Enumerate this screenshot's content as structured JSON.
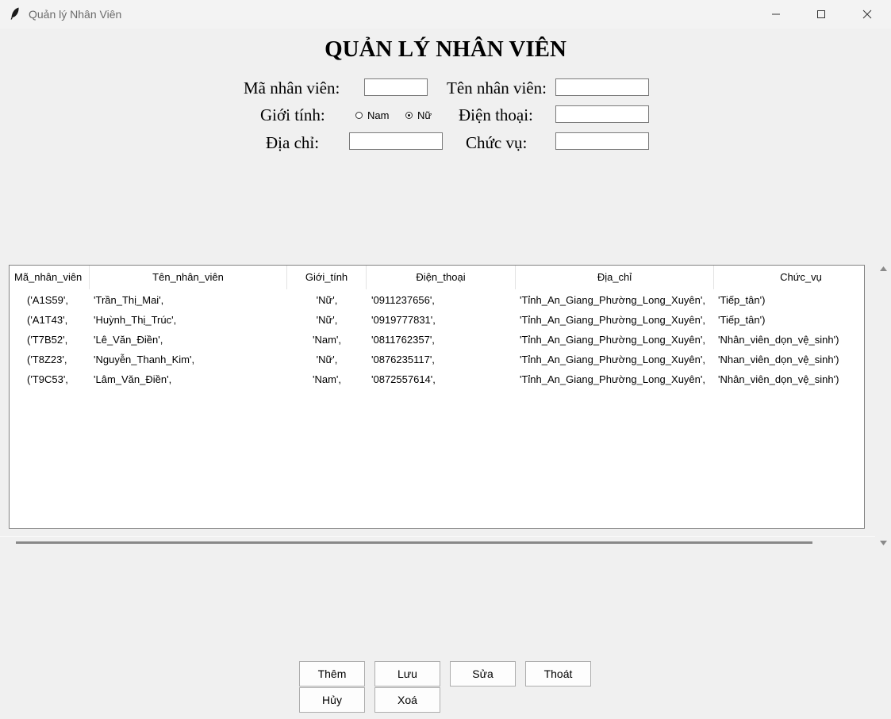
{
  "window": {
    "title": "Quản lý Nhân Viên"
  },
  "form": {
    "heading": "QUẢN LÝ NHÂN VIÊN",
    "ma_label": "Mã nhân viên:",
    "ten_label": "Tên nhân viên:",
    "gioitinh_label": "Giới tính:",
    "radio_nam": "Nam",
    "radio_nu": "Nữ",
    "gender_selected": "Nữ",
    "dienthoai_label": "Điện thoại:",
    "diachi_label": "Địa chỉ:",
    "chucvu_label": "Chức vụ:",
    "ma_value": "",
    "ten_value": "",
    "dienthoai_value": "",
    "diachi_value": "",
    "chucvu_value": ""
  },
  "table": {
    "columns": [
      "Mã_nhân_viên",
      "Tên_nhân_viên",
      "Giới_tính",
      "Điện_thoại",
      "Địa_chỉ",
      "Chức_vụ"
    ],
    "rows": [
      [
        "('A1S59',",
        "'Trần_Thị_Mai',",
        "'Nữ',",
        "'0911237656',",
        "'Tỉnh_An_Giang_Phường_Long_Xuyên',",
        "'Tiếp_tân')"
      ],
      [
        "('A1T43',",
        "'Huỳnh_Thị_Trúc',",
        "'Nữ',",
        "'0919777831',",
        "'Tỉnh_An_Giang_Phường_Long_Xuyên',",
        "'Tiếp_tân')"
      ],
      [
        "('T7B52',",
        "'Lê_Văn_Điền',",
        "'Nam',",
        "'0811762357',",
        "'Tỉnh_An_Giang_Phường_Long_Xuyên',",
        "'Nhân_viên_dọn_vệ_sinh')"
      ],
      [
        "('T8Z23',",
        "'Nguyễn_Thanh_Kim',",
        "'Nữ',",
        "'0876235117',",
        "'Tỉnh_An_Giang_Phường_Long_Xuyên',",
        "'Nhan_viên_dọn_vệ_sinh')"
      ],
      [
        "('T9C53',",
        "'Lâm_Văn_Điền',",
        "'Nam',",
        "'0872557614',",
        "'Tỉnh_An_Giang_Phường_Long_Xuyên',",
        "'Nhân_viên_dọn_vệ_sinh')"
      ]
    ]
  },
  "buttons": {
    "them": "Thêm",
    "luu": "Lưu",
    "sua": "Sửa",
    "thoat": "Thoát",
    "huy": "Hủy",
    "xoa": "Xoá"
  },
  "icons": {
    "app": "feather-icon",
    "minimize": "minimize-icon",
    "maximize": "maximize-icon",
    "close": "close-icon",
    "scroll_up": "arrow-up-icon",
    "scroll_down": "arrow-down-icon"
  }
}
